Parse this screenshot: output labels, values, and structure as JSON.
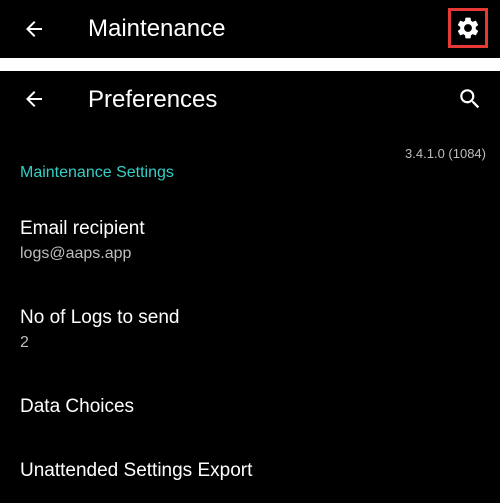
{
  "top_bar": {
    "title": "Maintenance",
    "back_icon": "arrow-left-icon",
    "settings_icon": "gear-icon",
    "highlight_color": "#e53935"
  },
  "pref_bar": {
    "title": "Preferences",
    "back_icon": "arrow-left-icon",
    "search_icon": "search-icon"
  },
  "version": "3.4.1.0 (1084)",
  "section": {
    "title": "Maintenance Settings",
    "accent_color": "#35d0c8"
  },
  "items": [
    {
      "title": "Email recipient",
      "summary": "logs@aaps.app"
    },
    {
      "title": "No of Logs to send",
      "summary": "2"
    },
    {
      "title": "Data Choices"
    },
    {
      "title": "Unattended Settings Export"
    }
  ]
}
